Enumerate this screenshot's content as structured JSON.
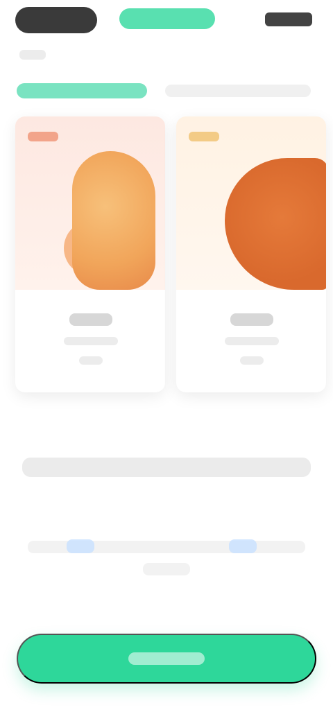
{
  "theme": {
    "accent": "#2ed79a",
    "accent_soft": "#59e0b0",
    "tab_active": "#7ae3c1",
    "card_left_tint": "#fde8e1",
    "card_right_tint": "#fff2e3",
    "illustration_left": "#f1a55a",
    "illustration_right": "#d9692d"
  },
  "status_bar": {
    "left_icon": "time-pill",
    "center_icon": "activity-pill",
    "right_icons": "signal-wifi-battery-icons"
  },
  "tabs": [
    {
      "label": "",
      "active": true
    },
    {
      "label": "",
      "active": false
    }
  ],
  "cards": [
    {
      "tag": "",
      "title": "",
      "subtitle": "",
      "meta": "",
      "illustration": "portrait-illustration"
    },
    {
      "tag": "",
      "title": "",
      "subtitle": "",
      "meta": "",
      "illustration": "horse-illustration"
    }
  ],
  "message": "",
  "legal": {
    "text": "",
    "link1": "",
    "link2": ""
  },
  "cta": {
    "label": ""
  }
}
